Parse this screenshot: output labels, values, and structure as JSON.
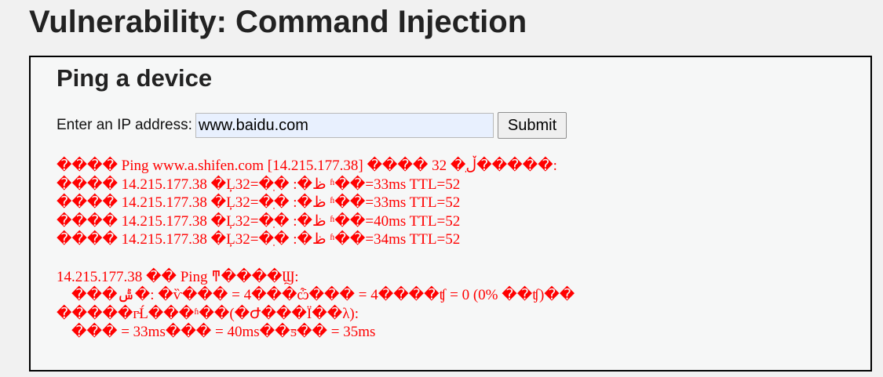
{
  "page": {
    "title": "Vulnerability: Command Injection"
  },
  "form": {
    "heading": "Ping a device",
    "ip_label": "Enter an IP address:",
    "ip_value": "www.baidu.com",
    "submit_label": "Submit"
  },
  "output": {
    "lines": [
      "���� Ping www.a.shifen.com [14.215.177.38] ���� 32 �ֽڵ�����:",
      "���� 14.215.177.38 �Ļظ�: �ֽ�=32 ʱ��=33ms TTL=52",
      "���� 14.215.177.38 �Ļظ�: �ֽ�=32 ʱ��=33ms TTL=52",
      "���� 14.215.177.38 �Ļظ�: �ֽ�=32 ʱ��=40ms TTL=52",
      "���� 14.215.177.38 �Ļظ�: �ֽ�=32 ʱ��=34ms TTL=52",
      "",
      "14.215.177.38 �� Ping ͳ����Ϣ:",
      "    ���ݰ�: �ѷ��� = 4���ѽ��� = 4����ʧ = 0 (0% ��ʧ)��",
      "�����г̵Ĺ���ʱ��(�Ժ���Ϊ��λ):",
      "    ��� = 33ms��� = 40ms��ƽ�� = 35ms"
    ]
  },
  "colors": {
    "output_text": "#ff0000",
    "page_background": "#f1f1f1",
    "box_background": "#f6f7f7",
    "input_background": "#e8f0fe"
  }
}
